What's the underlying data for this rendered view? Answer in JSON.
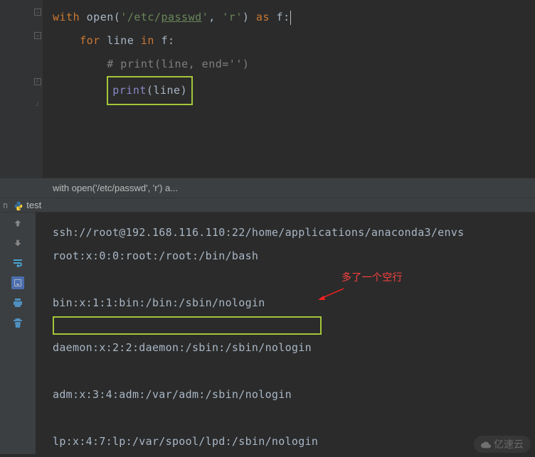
{
  "code": {
    "line1": {
      "kw_with": "with",
      "builtin_open": "open",
      "paren_open": "(",
      "str_prefix": "'",
      "str_path_plain": "/etc/",
      "str_path_underlined": "passwd",
      "str_suffix": "'",
      "comma": ", ",
      "str_mode": "'r'",
      "paren_close": ")",
      "kw_as": " as ",
      "ident": "f",
      "colon": ":"
    },
    "line2": {
      "indent": "    ",
      "kw_for": "for",
      "ident_line": " line ",
      "kw_in": "in",
      "ident_f": " f",
      "colon": ":"
    },
    "line3": {
      "indent": "        ",
      "comment": "# print(line, end='')"
    },
    "line4": {
      "indent": "        ",
      "builtin_print": "print",
      "paren_open": "(",
      "ident": "line",
      "paren_close": ")"
    }
  },
  "breadcrumb": "with open('/etc/passwd', 'r') a...",
  "tab": {
    "prefix": "n",
    "label": "test"
  },
  "output": {
    "line1": "ssh://root@192.168.116.110:22/home/applications/anaconda3/envs",
    "line2": "root:x:0:0:root:/root:/bin/bash",
    "line3": "",
    "line4": "bin:x:1:1:bin:/bin:/sbin/nologin",
    "line5": "",
    "line6": "daemon:x:2:2:daemon:/sbin:/sbin/nologin",
    "line7": "",
    "line8": "adm:x:3:4:adm:/var/adm:/sbin/nologin",
    "line9": "",
    "line10": "lp:x:4:7:lp:/var/spool/lpd:/sbin/nologin"
  },
  "annotation": "多了一个空行",
  "watermark": "亿速云"
}
